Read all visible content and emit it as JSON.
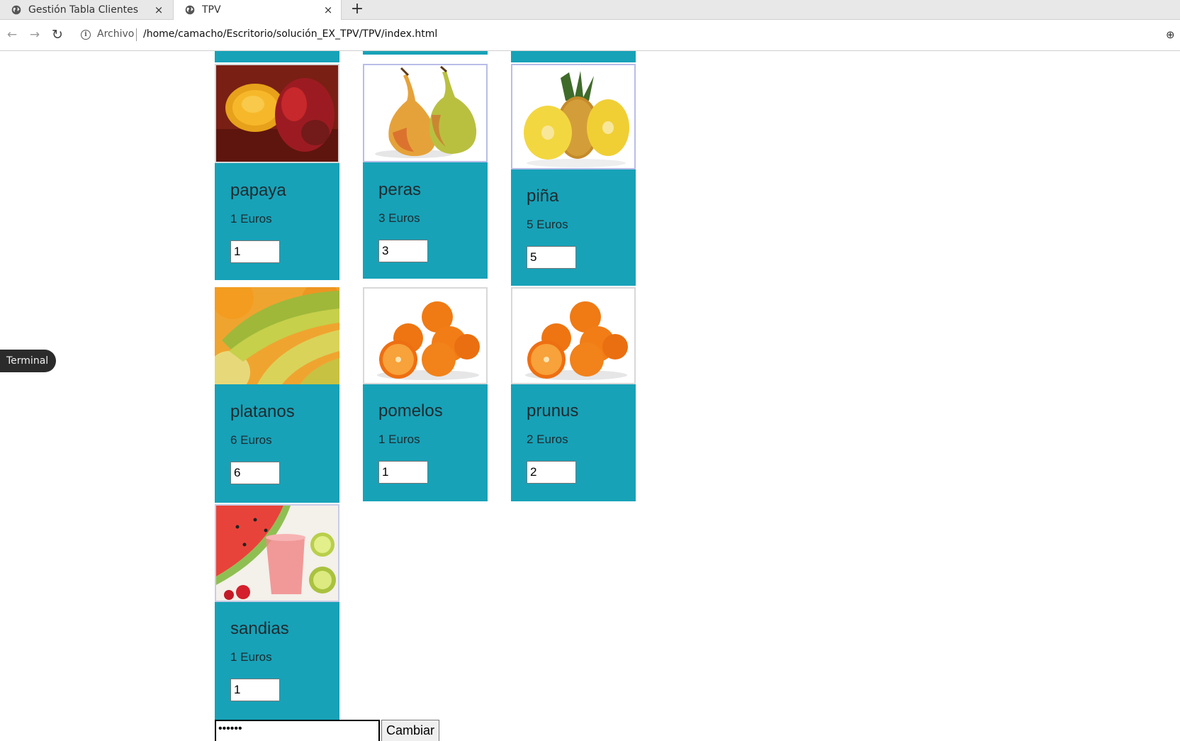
{
  "browser": {
    "tabs": [
      {
        "title": "Gestión Tabla Clientes",
        "close": "×"
      },
      {
        "title": "TPV",
        "close": "×"
      }
    ],
    "new_tab": "+",
    "nav": {
      "back": "←",
      "forward": "→",
      "reload": "↻"
    },
    "info": "i",
    "scheme_label": "Archivo",
    "url": "/home/camacho/Escritorio/solución_EX_TPV/TPV/index.html",
    "zoom": "⊕"
  },
  "tooltip": {
    "label": "Terminal"
  },
  "products": [
    {
      "name": "papaya",
      "price": "1 Euros",
      "qty": "1",
      "image": "papaya-image"
    },
    {
      "name": "peras",
      "price": "3 Euros",
      "qty": "3",
      "image": "pears-image"
    },
    {
      "name": "piña",
      "price": "5 Euros",
      "qty": "5",
      "image": "pineapple-image"
    },
    {
      "name": "platanos",
      "price": "6 Euros",
      "qty": "6",
      "image": "bananas-image"
    },
    {
      "name": "pomelos",
      "price": "1 Euros",
      "qty": "1",
      "image": "oranges-image"
    },
    {
      "name": "prunus",
      "price": "2 Euros",
      "qty": "2",
      "image": "oranges-image"
    },
    {
      "name": "sandias",
      "price": "1 Euros",
      "qty": "1",
      "image": "watermelon-image"
    }
  ],
  "form": {
    "password_value": "••••••",
    "submit_label": "Cambiar"
  },
  "colors": {
    "card": "#17a2b8",
    "tab_bar": "#e8e8e8"
  }
}
